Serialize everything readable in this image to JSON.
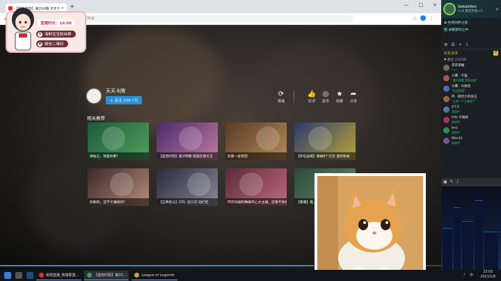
{
  "browser": {
    "tab_title": "【蓝色时刻】第204期 天天卡牌",
    "url": "tdshi.com/video/BV1whH127CD",
    "close": "×",
    "new_tab": "+",
    "min": "—",
    "max": "□",
    "win_close": "×"
  },
  "overlay": {
    "live_time": "直播时长：16:00",
    "pill1": "海鲜宝宝粉丝群",
    "pill2": "微信二维码",
    "pill1_badge": "Q",
    "pill2_badge": "微"
  },
  "channel": {
    "name": "天天卡牌",
    "follow": "+ 关注 229.7万"
  },
  "controls": [
    {
      "icon": "⟳",
      "label": "换播"
    },
    {
      "icon": "👍",
      "label": "好评"
    },
    {
      "icon": "◎",
      "label": "投币"
    },
    {
      "icon": "★",
      "label": "收藏"
    },
    {
      "icon": "➦",
      "label": "分享"
    }
  ],
  "related": {
    "title": "相关推荐",
    "items": [
      {
        "caption": "胡站王，我是你爹!",
        "color1": "#1d5a3a",
        "color2": "#4fa05d"
      },
      {
        "caption": "【蓝色时刻】第208期 就是在惊天王",
        "color1": "#4a2a6a",
        "color2": "#c07aa0"
      },
      {
        "caption": "玩家一金军团",
        "color1": "#5a3a26",
        "color2": "#b58a55"
      },
      {
        "caption": "【炉石战棋】暴掉6个元牙 连的和局",
        "color1": "#2a3a6a",
        "color2": "#b9a33a"
      },
      {
        "caption": "刺刺的，这不卡满如何?",
        "color1": "#3a2a2a",
        "color2": "#b88a7a"
      },
      {
        "caption": "【王牌名公】201: 还三次 动打吃",
        "color1": "#2a2a3a",
        "color2": "#888899"
      },
      {
        "caption": "PDD双解的精解开心大主播，还看不到他的",
        "color1": "#5a2a3a",
        "color2": "#c06a7a"
      },
      {
        "caption": "【暴暴】看上本炉石一身子",
        "color1": "#2a4a3a",
        "color2": "#6a8a6a"
      }
    ]
  },
  "progress": 0.71,
  "panel": {
    "user": "Sebastien",
    "user_sub": "Lv.8 集结英雄+3",
    "sec1": "✿ 生死同伴之前",
    "sec2": "图 卓越游玩之中",
    "friends_label": "好友请求",
    "friends_badge": "0",
    "tools": [
      "⚙",
      "☰",
      "+",
      "⇩"
    ],
    "group_label": "▼ 最近 (10/18)",
    "friends": [
      {
        "name": "李宗单推",
        "status": "\"十\"",
        "color": "#7a6a55"
      },
      {
        "name": "斗鹰 · 宁猫",
        "status": "\"遇不惜看 然后自宙\"",
        "color": "#aa5544"
      },
      {
        "name": "斗鹰 · 众呢悲",
        "status": "\"浩浩荡荡\"",
        "color": "#5566aa"
      },
      {
        "name": "鸣 · 薛伦大的骑王",
        "status": "\"让我一个王者到了\"",
        "color": "#996633"
      },
      {
        "name": "Z个Z",
        "status": "游戏中",
        "color": "#557799"
      },
      {
        "name": "Fthl 千情牌",
        "status": "游戏中",
        "color": "#aa3355"
      },
      {
        "name": "ferz",
        "status": "游戏中",
        "color": "#338855"
      },
      {
        "name": "Mim31",
        "status": "游戏中",
        "color": "#775599"
      }
    ]
  },
  "taskbar": {
    "items": [
      {
        "label": "组观直播_英雄联盟...",
        "color": "#dd3333"
      },
      {
        "label": "【蓝色时刻】第20...",
        "color": "#22aa55"
      },
      {
        "label": "League of Legends",
        "color": "#c8a24a"
      }
    ],
    "time": "23:03",
    "date": "2021/1/8",
    "lang": "中",
    "vol": "♪"
  }
}
